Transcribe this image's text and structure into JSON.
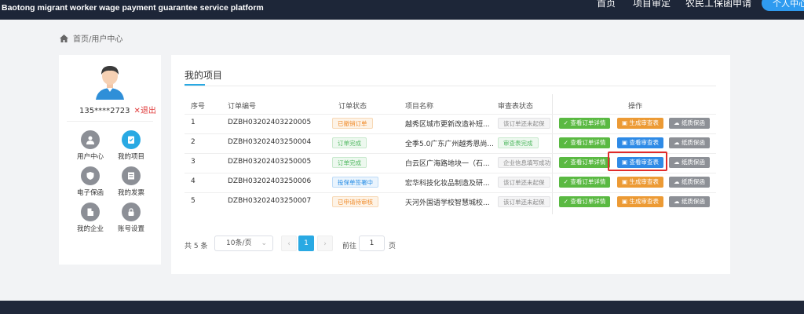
{
  "header": {
    "platform_title": "Baotong migrant worker wage payment guarantee service platform",
    "nav": [
      "首页",
      "项目审定",
      "农民工保函申请"
    ],
    "button_label": "个人中心"
  },
  "breadcrumb": "首页/用户中心",
  "user": {
    "phone": "135****2723",
    "logout": "退出"
  },
  "menu": [
    "用户中心",
    "我的项目",
    "电子保函",
    "我的发票",
    "我的企业",
    "账号设置"
  ],
  "main": {
    "title": "我的项目",
    "headers": [
      "序号",
      "订单编号",
      "订单状态",
      "项目名称",
      "审查表状态",
      "操作"
    ],
    "rows": [
      {
        "idx": "1",
        "order_no": "DZBH03202403220005",
        "status": "已撤销订单",
        "status_color": "orange",
        "project": "越秀区城市更新改造补短...",
        "review": "该订单还未起保",
        "review_color": "gray",
        "action2": "生成审查表",
        "action2_color": "orange"
      },
      {
        "idx": "2",
        "order_no": "DZBH03202403250004",
        "status": "订单完成",
        "status_color": "green",
        "project": "全季5.0广东广州越秀恩尚...",
        "review": "审查表完成",
        "review_color": "green",
        "action2": "查看审查表",
        "action2_color": "blue"
      },
      {
        "idx": "3",
        "order_no": "DZBH03202403250005",
        "status": "订单完成",
        "status_color": "green",
        "project": "白云区广海路地块一（石...",
        "review": "企业信息填写成功,",
        "review_color": "gray",
        "action2": "查看审查表",
        "action2_color": "blue"
      },
      {
        "idx": "4",
        "order_no": "DZBH03202403250006",
        "status": "投保单签署中",
        "status_color": "blue",
        "project": "宏华科技化妆品制造及研...",
        "review": "该订单还未起保",
        "review_color": "gray",
        "action2": "生成审查表",
        "action2_color": "orange"
      },
      {
        "idx": "5",
        "order_no": "DZBH03202403250007",
        "status": "已申请待审核",
        "status_color": "orange",
        "project": "天河外国语学校智慧城校...",
        "review": "该订单还未起保",
        "review_color": "gray",
        "action2": "生成审查表",
        "action2_color": "orange"
      }
    ],
    "action1": "查看订单详情",
    "action3": "纸质保函"
  },
  "pagination": {
    "total": "共 5 条",
    "page_size": "10条/页",
    "current": "1",
    "goto": "前往",
    "goto_value": "1",
    "page_unit": "页"
  },
  "colors": {
    "accent": "#29a9e3",
    "topbar": "#1d2638",
    "highlight": "#e02b2b"
  }
}
